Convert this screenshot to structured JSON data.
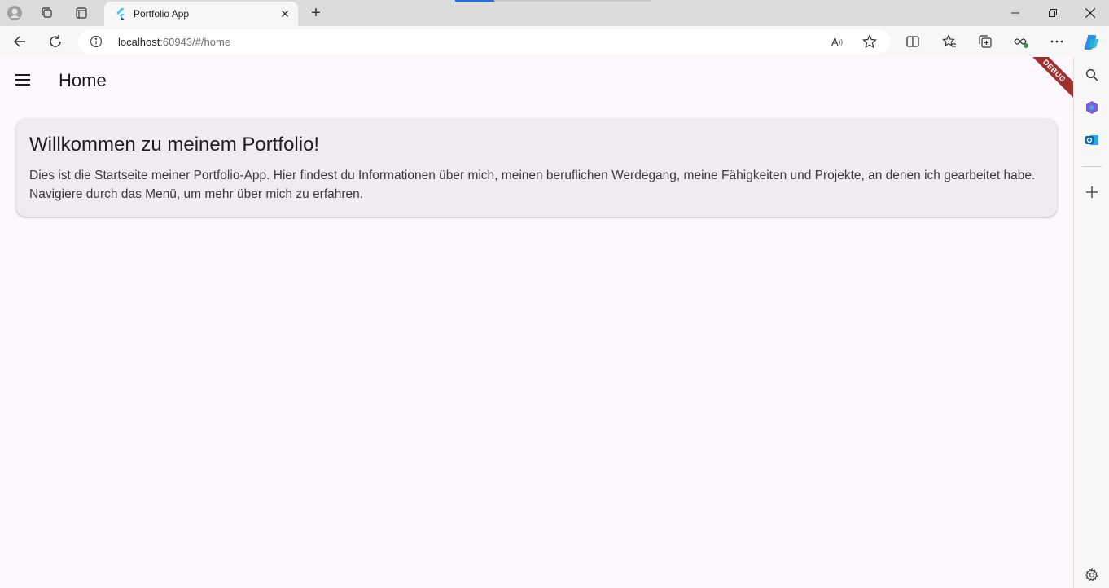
{
  "browser": {
    "tab": {
      "title": "Portfolio App"
    },
    "address": {
      "host": "localhost",
      "path": ":60943/#/home"
    },
    "load_progress": 0.2
  },
  "app": {
    "appbar_title": "Home",
    "debug_banner": "DEBUG",
    "card": {
      "title": "Willkommen zu meinem Portfolio!",
      "body": "Dies ist die Startseite meiner Portfolio-App. Hier findest du Informationen über mich, meinen beruflichen Werdegang, meine Fähigkeiten und Projekte, an denen ich gearbeitet habe. Navigiere durch das Menü, um mehr über mich zu erfahren."
    }
  },
  "colors": {
    "page_background": "#fef7fe",
    "card_background": "#f0eaf3",
    "debug_banner": "#a03030",
    "flutter_blue": "#47c5fb"
  },
  "icons": {
    "toolbar": [
      "back-icon",
      "refresh-icon",
      "info-icon",
      "read-aloud-icon",
      "favorite-star-icon",
      "split-screen-icon",
      "favorites-icon",
      "collections-icon",
      "browser-essentials-icon",
      "more-icon",
      "copilot-icon"
    ],
    "sidebar": [
      "search-icon",
      "office-icon",
      "outlook-icon",
      "add-icon",
      "settings-icon"
    ]
  }
}
